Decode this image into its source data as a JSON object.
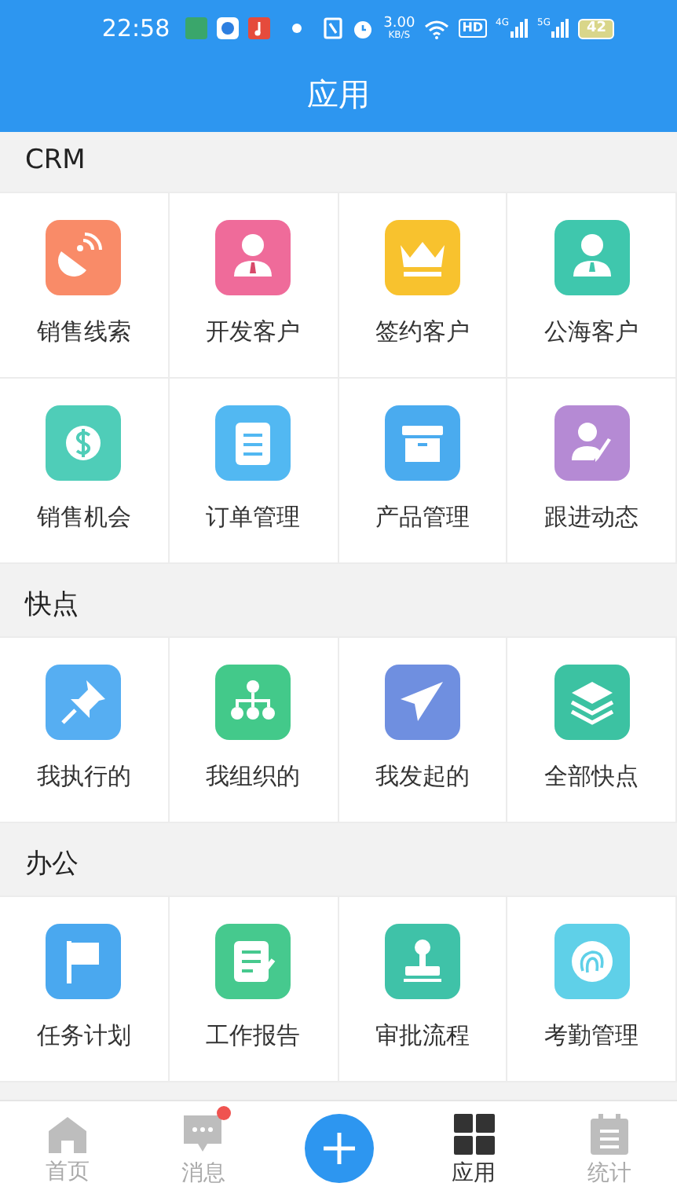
{
  "status_bar": {
    "time": "22:58",
    "speed": "3.00",
    "speed_unit": "KB/S",
    "hd": "HD",
    "net1": "4G",
    "net2": "5G",
    "battery": "42"
  },
  "header": {
    "title": "应用"
  },
  "sections": [
    {
      "title": "CRM",
      "items": [
        {
          "label": "销售线索",
          "color": "#f98b68"
        },
        {
          "label": "开发客户",
          "color": "#ef6b9a"
        },
        {
          "label": "签约客户",
          "color": "#f8c22e"
        },
        {
          "label": "公海客户",
          "color": "#3fc7ad"
        },
        {
          "label": "销售机会",
          "color": "#4fcdb8"
        },
        {
          "label": "订单管理",
          "color": "#52b8f2"
        },
        {
          "label": "产品管理",
          "color": "#4aabef"
        },
        {
          "label": "跟进动态",
          "color": "#b58ad4"
        }
      ]
    },
    {
      "title": "快点",
      "items": [
        {
          "label": "我执行的",
          "color": "#56aef2"
        },
        {
          "label": "我组织的",
          "color": "#43c98a"
        },
        {
          "label": "我发起的",
          "color": "#6f8fe0"
        },
        {
          "label": "全部快点",
          "color": "#3cc2a2"
        }
      ]
    },
    {
      "title": "办公",
      "items": [
        {
          "label": "任务计划",
          "color": "#4aa8ef"
        },
        {
          "label": "工作报告",
          "color": "#46c98e"
        },
        {
          "label": "审批流程",
          "color": "#3fc2a8"
        },
        {
          "label": "考勤管理",
          "color": "#5fd0e8"
        }
      ]
    }
  ],
  "bottom_nav": [
    {
      "kind": "tab",
      "label": "首页",
      "selected": false,
      "badge": false
    },
    {
      "kind": "tab",
      "label": "消息",
      "selected": false,
      "badge": true
    },
    {
      "kind": "add"
    },
    {
      "kind": "tab",
      "label": "应用",
      "selected": true,
      "badge": false
    },
    {
      "kind": "tab",
      "label": "统计",
      "selected": false,
      "badge": false
    }
  ]
}
